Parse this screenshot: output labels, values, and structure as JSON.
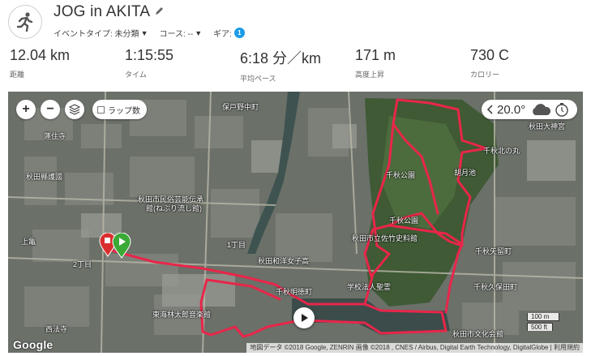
{
  "header": {
    "title": "JOG in AKITA",
    "activity_type_label": "イベントタイプ: 未分類",
    "course_label": "コース: --",
    "gear_label": "ギア:",
    "gear_count": "1",
    "runner_icon": "runner-icon",
    "edit_icon": "pencil-icon"
  },
  "stats": [
    {
      "value": "12.04 km",
      "label": "距離"
    },
    {
      "value": "1:15:55",
      "label": "タイム"
    },
    {
      "value": "6:18 分／km",
      "label": "平均ペース"
    },
    {
      "value": "171 m",
      "label": "高度上昇"
    },
    {
      "value": "730 C",
      "label": "カロリー"
    }
  ],
  "map": {
    "lap_label": "ラップ数",
    "zoom_in": "+",
    "zoom_out": "−",
    "temperature": "20.0°",
    "weather_icon": "cloud-icon",
    "scale_metric": "100 m",
    "scale_imperial": "500 ft",
    "google": "Google",
    "attribution": "地図データ ©2018 Google, ZENRIN 画像 ©2018 , CNES / Airbus, Digital Earth Technology, DigitalGlobe | 利用規約",
    "route_color": "#e8264a",
    "labels": [
      {
        "text": "保戸野中町"
      },
      {
        "text": "蓮住寺"
      },
      {
        "text": "秋田縣護國"
      },
      {
        "text": "秋田市民俗芸能伝承"
      },
      {
        "text": "館(ねぶり流し館)"
      },
      {
        "text": "千秋公園"
      },
      {
        "text": "胡月池"
      },
      {
        "text": "秋田大神宮"
      },
      {
        "text": "千秋公園"
      },
      {
        "text": "秋田市立佐竹史料館"
      },
      {
        "text": "秋田和洋女子高"
      },
      {
        "text": "千秋明徳町"
      },
      {
        "text": "東海林太郎音楽館"
      },
      {
        "text": "学校法人聖霊"
      },
      {
        "text": "千秋久保田町"
      },
      {
        "text": "千秋矢留町"
      },
      {
        "text": "上亀"
      },
      {
        "text": "2丁目"
      },
      {
        "text": "1丁目"
      },
      {
        "text": "西法寺"
      },
      {
        "text": "千秋北の丸"
      },
      {
        "text": "秋田市文化会館"
      }
    ]
  }
}
